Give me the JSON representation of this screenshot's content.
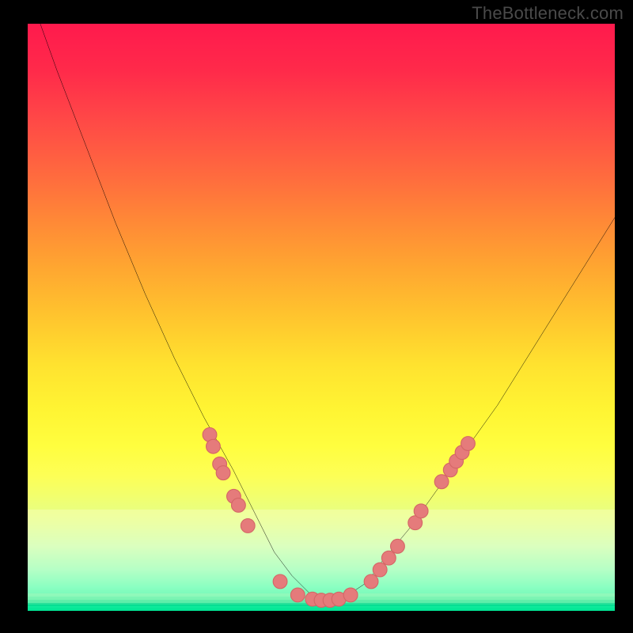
{
  "watermark": "TheBottleneck.com",
  "colors": {
    "frame": "#000000",
    "stroke": "#000000",
    "dot_fill": "#e57b7b",
    "dot_stroke": "#d46666"
  },
  "chart_data": {
    "type": "line",
    "title": "",
    "xlabel": "",
    "ylabel": "",
    "xlim": [
      0,
      100
    ],
    "ylim": [
      0,
      100
    ],
    "grid": false,
    "series": [
      {
        "name": "curve",
        "x": [
          0,
          5,
          10,
          15,
          20,
          25,
          30,
          35,
          40,
          42,
          45,
          48,
          50,
          52,
          55,
          58,
          60,
          65,
          70,
          75,
          80,
          85,
          90,
          95,
          100
        ],
        "y": [
          106,
          92,
          79,
          66,
          54,
          43,
          33,
          24,
          14,
          10,
          6,
          3,
          2,
          2,
          3,
          5,
          8,
          14,
          21,
          28,
          35,
          43,
          51,
          59,
          67
        ]
      }
    ],
    "markers": {
      "name": "dots",
      "x_y": [
        [
          31.0,
          30.0
        ],
        [
          31.6,
          28.0
        ],
        [
          32.7,
          25.0
        ],
        [
          33.3,
          23.5
        ],
        [
          35.1,
          19.5
        ],
        [
          35.9,
          18.0
        ],
        [
          37.5,
          14.5
        ],
        [
          43.0,
          5.0
        ],
        [
          46.0,
          2.7
        ],
        [
          48.5,
          2.0
        ],
        [
          50.0,
          1.8
        ],
        [
          51.5,
          1.8
        ],
        [
          53.0,
          2.0
        ],
        [
          55.0,
          2.7
        ],
        [
          58.5,
          5.0
        ],
        [
          60.0,
          7.0
        ],
        [
          61.5,
          9.0
        ],
        [
          63.0,
          11.0
        ],
        [
          66.0,
          15.0
        ],
        [
          67.0,
          17.0
        ],
        [
          70.5,
          22.0
        ],
        [
          72.0,
          24.0
        ],
        [
          73.0,
          25.5
        ],
        [
          74.0,
          27.0
        ],
        [
          75.0,
          28.5
        ]
      ],
      "radius": 1.2
    }
  }
}
